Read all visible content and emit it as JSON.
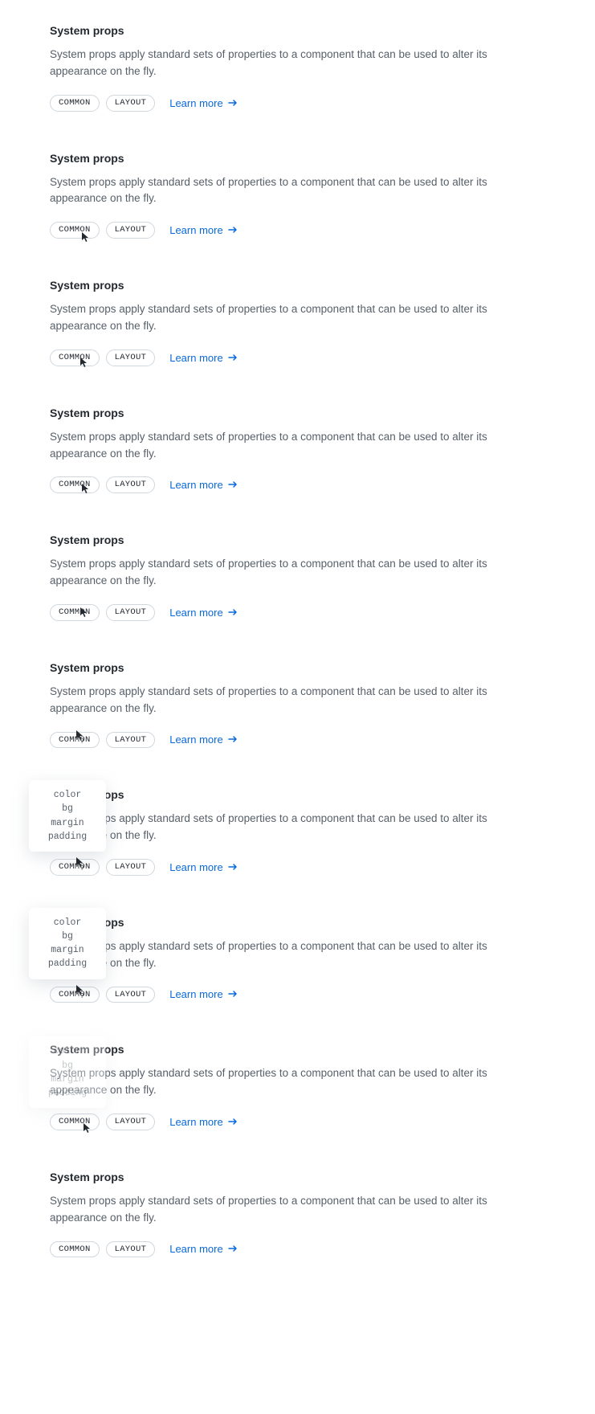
{
  "section": {
    "heading": "System props",
    "description": "System props apply standard sets of properties to a component that can be used to alter its appearance on the fly.",
    "pill_common": "COMMON",
    "pill_layout": "LAYOUT",
    "learn_more": "Learn more"
  },
  "tooltip": {
    "items": [
      "color",
      "bg",
      "margin",
      "padding"
    ]
  }
}
